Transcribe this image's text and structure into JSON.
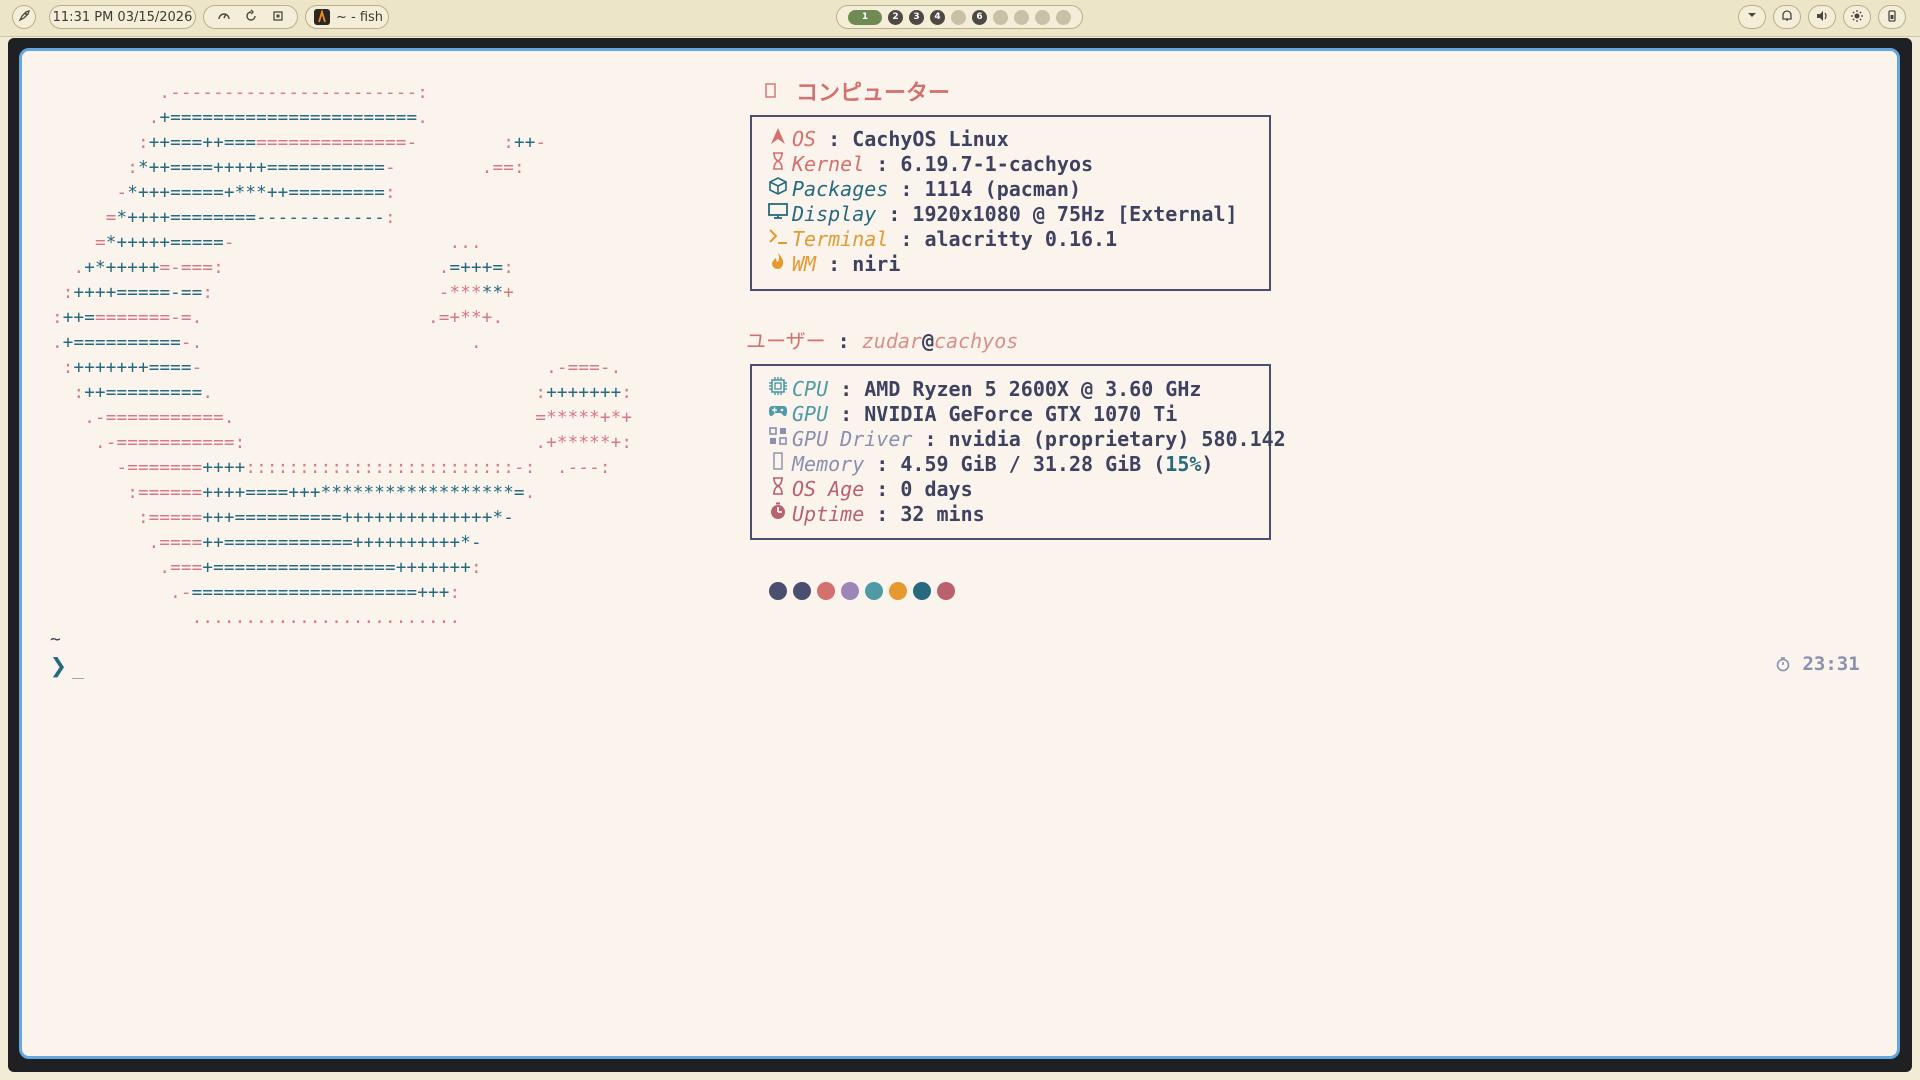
{
  "topbar": {
    "launcher_icon": "rocket-icon",
    "clock": "11:31 PM 03/15/2026",
    "indicator_icons": [
      "gauge-icon",
      "refresh-icon",
      "cpu-icon"
    ],
    "window_label": "~ - fish",
    "workspaces": [
      "1",
      "2",
      "3",
      "4",
      "",
      "6",
      "",
      "",
      "",
      ""
    ],
    "active_workspace": "1",
    "tray_icons": [
      "chevron-down-icon",
      "bell-icon",
      "volume-icon",
      "brightness-icon",
      "power-icon"
    ]
  },
  "fetch": {
    "header": {
      "icon": "desktop-icon",
      "text": "コンピューター"
    },
    "system": [
      {
        "label": "OS",
        "value": "CachyOS Linux",
        "icon": "arch-icon",
        "color": "#d4706e"
      },
      {
        "label": "Kernel",
        "value": "6.19.7-1-cachyos",
        "icon": "hourglass-icon",
        "color": "#d4706e"
      },
      {
        "label": "Packages",
        "value": "1114 (pacman)",
        "icon": "package-icon",
        "color": "#27697f"
      },
      {
        "label": "Display",
        "value": "1920x1080 @ 75Hz [External]",
        "icon": "monitor-icon",
        "color": "#27697f"
      },
      {
        "label": "Terminal",
        "value": "alacritty 0.16.1",
        "icon": "terminal-icon",
        "color": "#e59a2f"
      },
      {
        "label": "WM",
        "value": "niri",
        "icon": "flame-icon",
        "color": "#e59a2f"
      }
    ],
    "user": {
      "label": "ユーザー",
      "name": "zudar",
      "at": "@",
      "host": "cachyos"
    },
    "hardware": [
      {
        "label": "CPU",
        "value": "AMD Ryzen 5 2600X @ 3.60 GHz",
        "icon": "chip-icon",
        "color": "#4f9aa5"
      },
      {
        "label": "GPU",
        "value": "NVIDIA GeForce GTX 1070 Ti",
        "icon": "gamepad-icon",
        "color": "#4f9aa5"
      },
      {
        "label": "GPU Driver",
        "value": "nvidia (proprietary) 580.142",
        "icon": "grid-icon",
        "color": "#8b8fb0"
      },
      {
        "label": "Memory",
        "value": "4.59 GiB / 31.28 GiB (",
        "value_pct": "15%",
        "value_end": ")",
        "icon": "memory-icon",
        "color": "#8b8fb0"
      },
      {
        "label": "OS Age",
        "value": "0 days",
        "icon": "hourglass-icon",
        "color": "#b9616e"
      },
      {
        "label": "Uptime",
        "value": "32 mins",
        "icon": "timer-icon",
        "color": "#b9616e"
      }
    ],
    "palette": [
      "#4a4f70",
      "#4a4f70",
      "#d4706e",
      "#9c86b8",
      "#4f9aa5",
      "#e59a2f",
      "#27697f",
      "#b9616e"
    ]
  },
  "prompt": {
    "cwd": "~",
    "symbol": "❯",
    "cursor": "_",
    "right_icon": "timer-icon",
    "right_time": "23:31"
  }
}
